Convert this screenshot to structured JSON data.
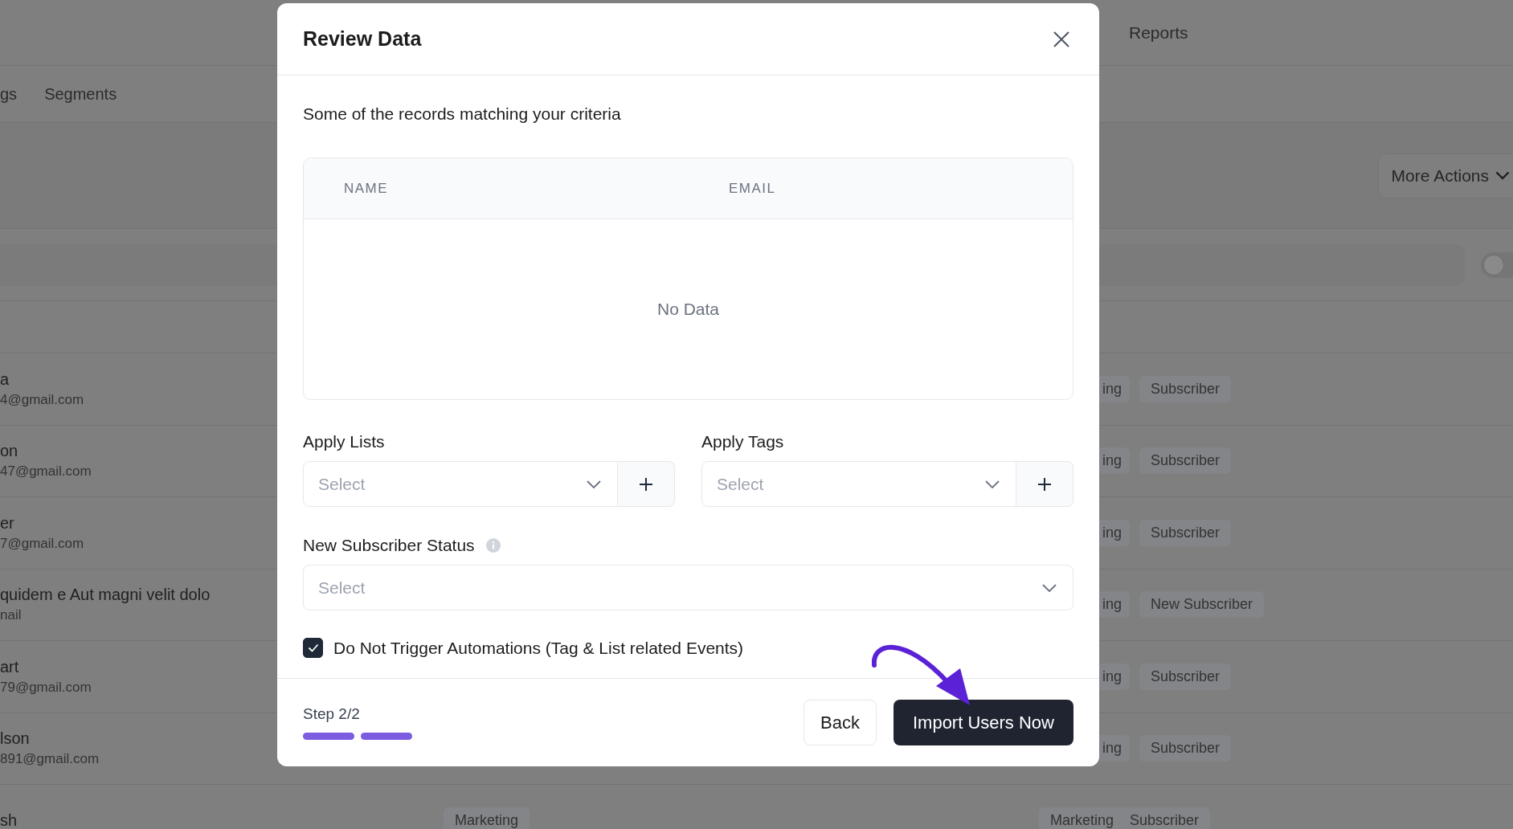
{
  "top_nav": {
    "items": [
      "Reports"
    ]
  },
  "sub_nav": {
    "items": [
      "gs",
      "Segments"
    ]
  },
  "more_actions": "More Actions",
  "filter_bar": {
    "toggle_on": false
  },
  "rows": [
    {
      "name": "a",
      "email": "4@gmail.com",
      "middle_tag": "",
      "list_tag": "ing",
      "status_tag": "Subscriber"
    },
    {
      "name": "on",
      "email": "47@gmail.com",
      "middle_tag": "",
      "list_tag": "ing",
      "status_tag": "Subscriber"
    },
    {
      "name": "er",
      "email": "7@gmail.com",
      "middle_tag": "",
      "list_tag": "ing",
      "status_tag": "Subscriber"
    },
    {
      "name": "quidem e Aut magni velit dolo",
      "email": "nail",
      "middle_tag": "",
      "list_tag": "ing",
      "status_tag": "New Subscriber"
    },
    {
      "name": "art",
      "email": "79@gmail.com",
      "middle_tag": "",
      "list_tag": "ing",
      "status_tag": "Subscriber"
    },
    {
      "name": "lson",
      "email": "891@gmail.com",
      "middle_tag": "",
      "list_tag": "ing",
      "status_tag": "Subscriber"
    },
    {
      "name": "sh",
      "email": "",
      "middle_tag": "Marketing",
      "list_tag": "Marketing",
      "status_tag": "Subscriber"
    }
  ],
  "modal": {
    "title": "Review Data",
    "subtitle": "Some of the records matching your criteria",
    "table": {
      "columns": [
        "NAME",
        "EMAIL"
      ],
      "empty_text": "No Data"
    },
    "apply_lists": {
      "label": "Apply Lists",
      "placeholder": "Select"
    },
    "apply_tags": {
      "label": "Apply Tags",
      "placeholder": "Select"
    },
    "status": {
      "label": "New Subscriber Status",
      "placeholder": "Select"
    },
    "no_trigger": {
      "label": "Do Not Trigger Automations (Tag & List related Events)",
      "checked": true
    },
    "step": "Step 2/2",
    "progress": [
      {
        "done": true
      },
      {
        "done": true
      }
    ],
    "back": "Back",
    "primary": "Import Users Now"
  }
}
